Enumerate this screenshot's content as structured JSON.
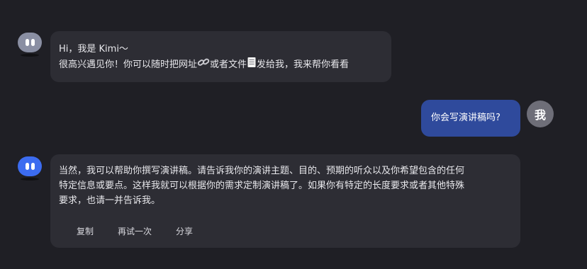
{
  "colors": {
    "background": "#1f1f25",
    "bot_bubble": "#2d2d34",
    "user_bubble": "#2f4a9c",
    "bot_avatar_greeting": "#8a8fa3",
    "bot_avatar_active": "#3c6cf0",
    "user_avatar": "#6e6e78"
  },
  "greeting": {
    "line1": "Hi，我是 Kimi～",
    "line2_a": "很高兴遇见你！你可以随时把网址",
    "line2_b": "或者文件",
    "line2_c": "发给我，我来帮你看看",
    "link_icon": "link-emoji-icon",
    "file_icon": "memo-emoji-icon"
  },
  "user_message": {
    "text": "你会写演讲稿吗?",
    "avatar_label": "我"
  },
  "bot_reply": {
    "line1": "当然，我可以帮助你撰写演讲稿。请告诉我你的演讲主题、目的、预期的听众以及你希望包含的任何",
    "line2": "特定信息或要点。这样我就可以根据你的需求定制演讲稿了。如果你有特定的长度要求或者其他特殊",
    "line3": "要求，也请一并告诉我。",
    "actions": {
      "copy": "复制",
      "retry": "再试一次",
      "share": "分享"
    }
  }
}
